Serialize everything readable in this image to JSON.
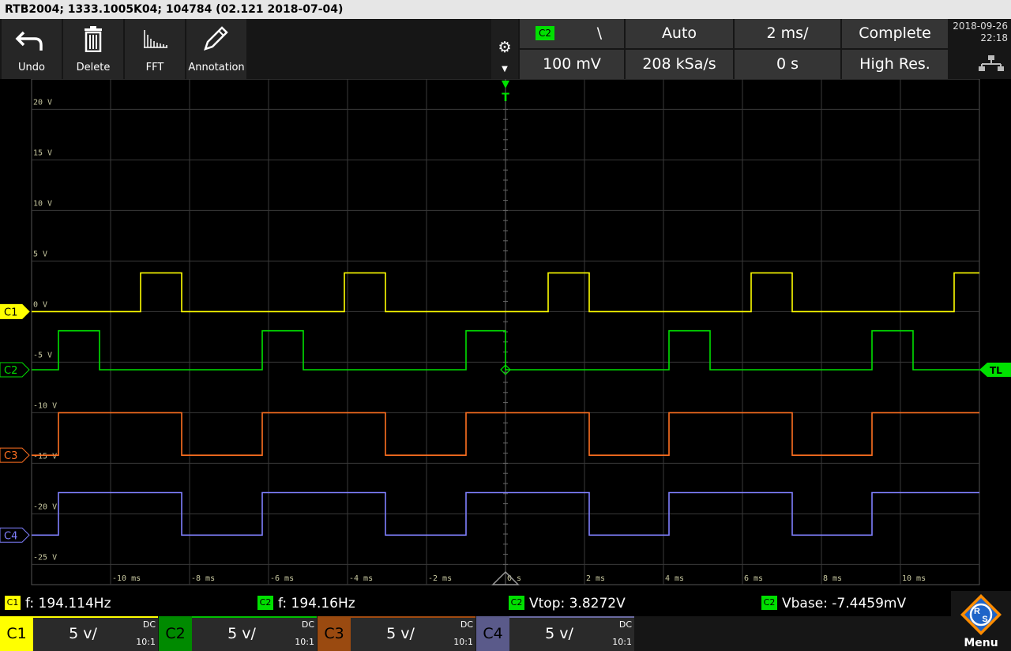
{
  "title": "RTB2004; 1333.1005K04; 104784 (02.121 2018-07-04)",
  "toolbar": {
    "tools": [
      {
        "label": "Undo",
        "icon": "undo-icon"
      },
      {
        "label": "Delete",
        "icon": "trash-icon"
      },
      {
        "label": "FFT",
        "icon": "fft-icon"
      },
      {
        "label": "Annotation",
        "icon": "pencil-icon"
      }
    ],
    "settings_icon": "⚙",
    "settings_down": "▼",
    "trigger_source": "C2",
    "trigger_slope_symbol": "\\",
    "trigger_mode": "Auto",
    "time_base": "2 ms/",
    "acq_state": "Complete",
    "trigger_level": "100 mV",
    "sample_rate": "208 kSa/s",
    "horiz_position": "0 s",
    "acq_mode": "High Res.",
    "date": "2018-09-26",
    "time": "22:18"
  },
  "grid": {
    "volt_labels": [
      "20 V",
      "15 V",
      "10 V",
      "5 V",
      "0 V",
      "-5 V",
      "-10 V",
      "-15 V",
      "-20 V",
      "-25 V"
    ],
    "time_labels": [
      "-10 ms",
      "-8 ms",
      "-6 ms",
      "-4 ms",
      "-2 ms",
      "0 s",
      "2 ms",
      "4 ms",
      "6 ms",
      "8 ms",
      "10 ms"
    ],
    "trigger_marker": "T",
    "trigger_level_label": "TL"
  },
  "channels": [
    {
      "name": "C1",
      "color": "#ffff00",
      "scale": "5 v/",
      "coupling": "DC",
      "probe": "10:1"
    },
    {
      "name": "C2",
      "color": "#00e000",
      "scale": "5 v/",
      "coupling": "DC",
      "probe": "10:1"
    },
    {
      "name": "C3",
      "color": "#ff7020",
      "scale": "5 v/",
      "coupling": "DC",
      "probe": "10:1"
    },
    {
      "name": "C4",
      "color": "#8080ff",
      "scale": "5 v/",
      "coupling": "DC",
      "probe": "10:1"
    }
  ],
  "measurements": [
    {
      "channel": "C1",
      "text": "f: 194.114Hz"
    },
    {
      "channel": "C2",
      "text": "f: 194.16Hz"
    },
    {
      "channel": "C2",
      "text": "Vtop: 3.8272V"
    },
    {
      "channel": "C2",
      "text": "Vbase: -7.4459mV"
    }
  ],
  "menu_label": "Menu",
  "chart_data": {
    "type": "line",
    "title": "",
    "xlabel": "",
    "ylabel": "",
    "x_unit": "ms",
    "y_unit": "V",
    "xlim": [
      -12,
      12
    ],
    "ylim": [
      -27,
      23
    ],
    "series": [
      {
        "name": "C1",
        "color": "#ffff00",
        "low": 0,
        "high": 3.83,
        "edges": [
          -9.24,
          -8.2,
          -4.08,
          -3.04,
          1.08,
          2.12,
          6.22,
          7.26,
          11.36
        ]
      },
      {
        "name": "C2",
        "color": "#00e000",
        "low": -5.75,
        "high": -1.9,
        "edges": [
          -11.32,
          -10.28,
          -6.16,
          -5.12,
          -1.0,
          0.0,
          4.14,
          5.18,
          9.28,
          10.32
        ]
      },
      {
        "name": "C3",
        "color": "#ff7020",
        "low": -14.2,
        "high": -10.0,
        "edges": [
          -11.32,
          -8.2,
          -6.16,
          -3.04,
          -1.0,
          2.12,
          4.14,
          7.26,
          9.28
        ]
      },
      {
        "name": "C4",
        "color": "#8080ff",
        "low": -22.1,
        "high": -17.9,
        "edges": [
          -11.32,
          -8.2,
          -6.16,
          -3.04,
          -1.0,
          2.12,
          4.14,
          7.26,
          9.28
        ]
      }
    ]
  }
}
